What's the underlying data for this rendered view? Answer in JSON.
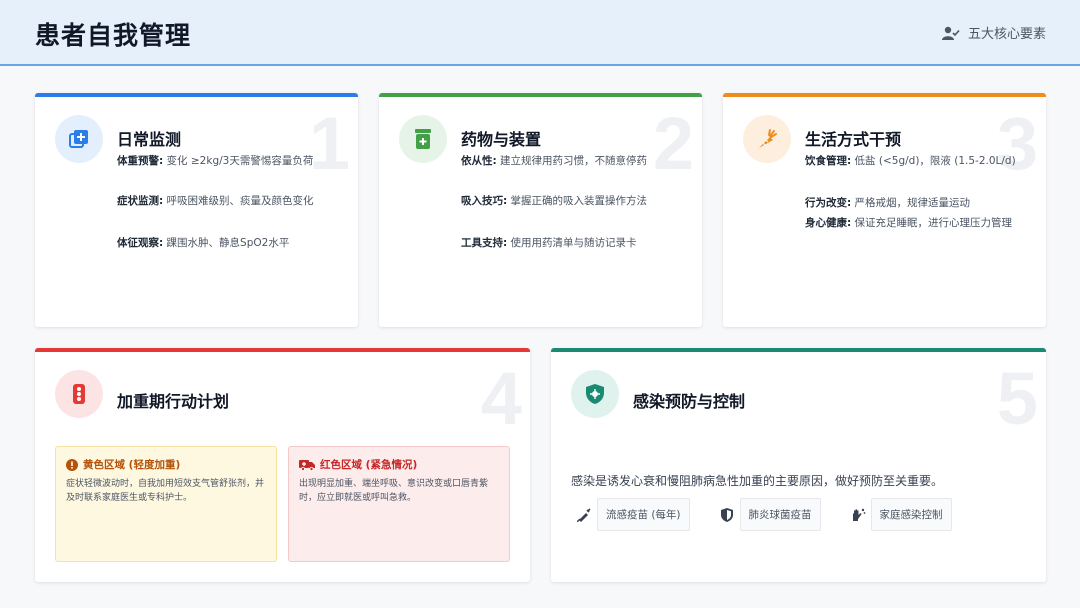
{
  "header": {
    "title": "患者自我管理",
    "badge": "五大核心要素"
  },
  "colors": {
    "blue": "#2b7de9",
    "green": "#43a047",
    "orange": "#f08c1e",
    "red": "#e53935",
    "teal": "#1b8a72"
  },
  "cards": {
    "monitoring": {
      "number": "1",
      "icon": "medical-plus-icon",
      "title": "日常监测",
      "items": [
        {
          "label": "体重预警:",
          "text": "变化 ≥2kg/3天需警惕容量负荷"
        },
        {
          "label": "症状监测:",
          "text": "呼吸困难级别、痰量及颜色变化"
        },
        {
          "label": "体征观察:",
          "text": "踝围水肿、静息SpO2水平"
        }
      ]
    },
    "medication": {
      "number": "2",
      "icon": "pill-bottle-icon",
      "title": "药物与装置",
      "items": [
        {
          "label": "依从性:",
          "text": "建立规律用药习惯，不随意停药"
        },
        {
          "label": "吸入技巧:",
          "text": "掌握正确的吸入装置操作方法"
        },
        {
          "label": "工具支持:",
          "text": "使用用药清单与随访记录卡"
        }
      ]
    },
    "lifestyle": {
      "number": "3",
      "icon": "carrot-icon",
      "title": "生活方式干预",
      "items": [
        {
          "label": "饮食管理:",
          "text": "低盐 (<5g/d)，限液 (1.5-2.0L/d)"
        },
        {
          "label": "行为改变:",
          "text": "严格戒烟，规律适量运动"
        },
        {
          "label": "身心健康:",
          "text": "保证充足睡眠，进行心理压力管理"
        }
      ]
    },
    "action_plan": {
      "number": "4",
      "icon": "traffic-light-icon",
      "title": "加重期行动计划",
      "yellow": {
        "title": "黄色区域 (轻度加重)",
        "text": "症状轻微波动时，自我加用短效支气管舒张剂，并及时联系家庭医生或专科护士。"
      },
      "red": {
        "title": "红色区域 (紧急情况)",
        "text": "出现明显加重、端坐呼吸、意识改变或口唇青紫时，应立即就医或呼叫急救。"
      }
    },
    "infection": {
      "number": "5",
      "icon": "shield-virus-icon",
      "title": "感染预防与控制",
      "description": "感染是诱发心衰和慢阻肺病急性加重的主要原因，做好预防至关重要。",
      "chips": [
        {
          "icon": "syringe-icon",
          "label": "流感疫苗 (每年)"
        },
        {
          "icon": "shield-icon",
          "label": "肺炎球菌疫苗"
        },
        {
          "icon": "hands-wash-icon",
          "label": "家庭感染控制"
        }
      ]
    }
  }
}
